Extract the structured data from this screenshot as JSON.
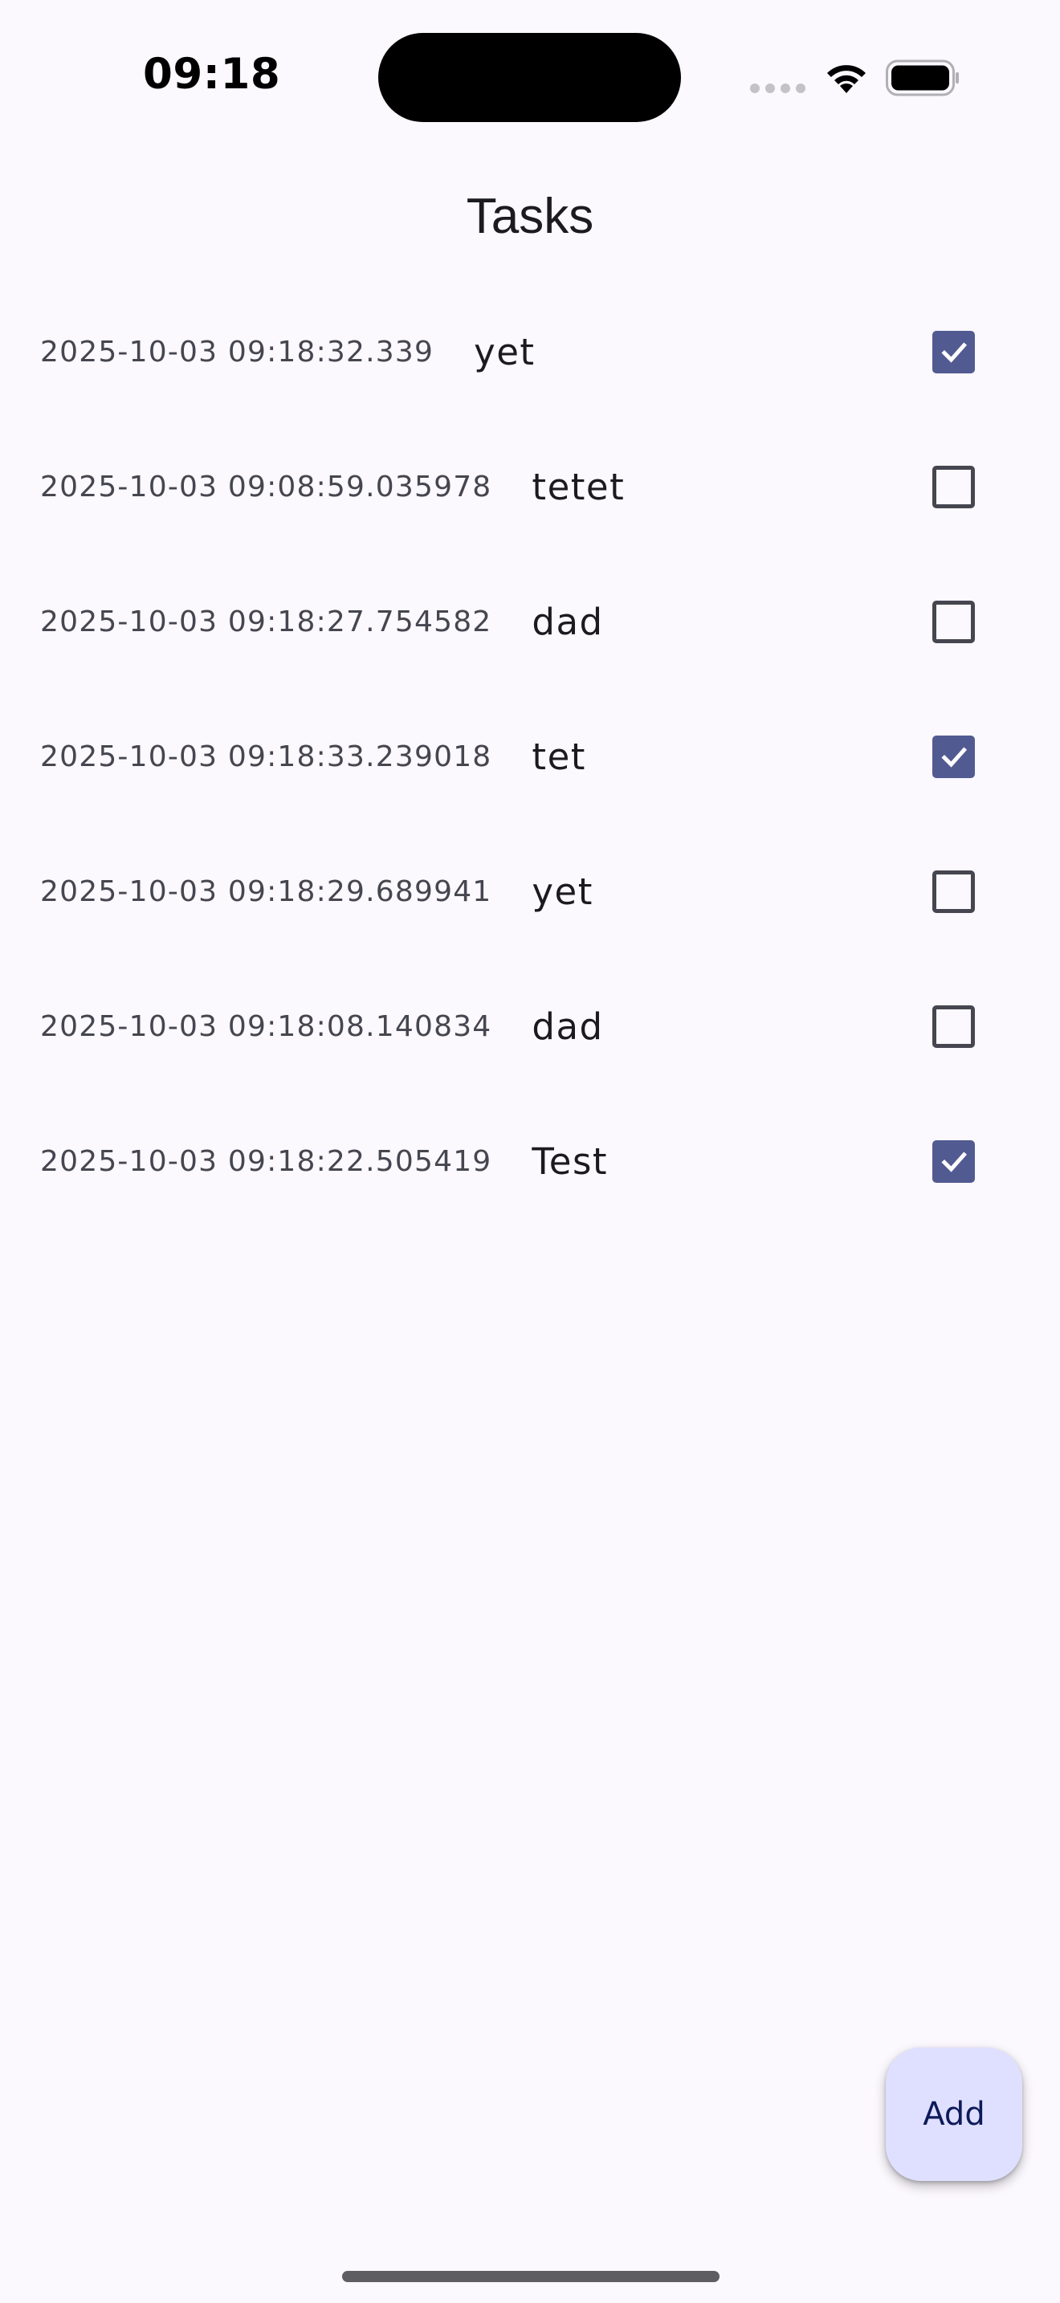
{
  "status_bar": {
    "time": "09:18",
    "icons": [
      "signal-dots-icon",
      "wifi-icon",
      "battery-icon"
    ]
  },
  "app_bar": {
    "title": "Tasks"
  },
  "tasks": [
    {
      "timestamp": "2025-10-03 09:18:32.339",
      "name": "yet",
      "checked": true
    },
    {
      "timestamp": "2025-10-03 09:08:59.035978",
      "name": "tetet",
      "checked": false
    },
    {
      "timestamp": "2025-10-03 09:18:27.754582",
      "name": "dad",
      "checked": false
    },
    {
      "timestamp": "2025-10-03 09:18:33.239018",
      "name": "tet",
      "checked": true
    },
    {
      "timestamp": "2025-10-03 09:18:29.689941",
      "name": "yet",
      "checked": false
    },
    {
      "timestamp": "2025-10-03 09:18:08.140834",
      "name": "dad",
      "checked": false
    },
    {
      "timestamp": "2025-10-03 09:18:22.505419",
      "name": "Test",
      "checked": true
    }
  ],
  "fab": {
    "label": "Add"
  },
  "colors": {
    "background": "#fbf8fe",
    "checkbox_checked": "#525a92",
    "checkbox_border": "#45464f",
    "fab_background": "#dfe0ff",
    "fab_text": "#0e1a59"
  }
}
